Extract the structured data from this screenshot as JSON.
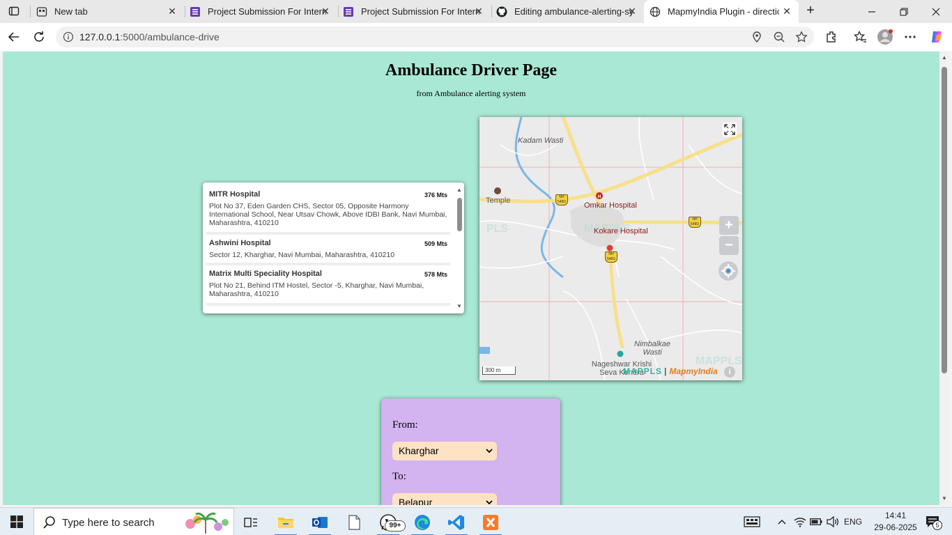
{
  "browser": {
    "tabs": [
      {
        "title": "New tab",
        "icon": "newtab-icon"
      },
      {
        "title": "Project Submission For Interns",
        "icon": "forms-icon"
      },
      {
        "title": "Project Submission For Interns",
        "icon": "forms-icon"
      },
      {
        "title": "Editing ambulance-alerting-sy",
        "icon": "github-icon"
      },
      {
        "title": "MapmyIndia Plugin - direction",
        "icon": "globe-icon"
      }
    ],
    "url_host": "127.0.0.1",
    "url_path": ":5000/ambulance-drive"
  },
  "page": {
    "title": "Ambulance Driver Page",
    "subtitle": "from Ambulance alerting system"
  },
  "hospitals": [
    {
      "name": "MITR Hospital",
      "distance": "376 Mts",
      "address": "Plot No 37, Eden Garden CHS, Sector 05, Opposite Harmony International School, Near Utsav Chowk, Above IDBI Bank, Navi Mumbai, Maharashtra, 410210"
    },
    {
      "name": "Ashwini Hospital",
      "distance": "509 Mts",
      "address": "Sector 12, Kharghar, Navi Mumbai, Maharashtra, 410210"
    },
    {
      "name": "Matrix Multi Speciality Hospital",
      "distance": "578 Mts",
      "address": "Plot No 21, Behind ITM Hostel, Sector -5, Kharghar, Navi Mumbai, Maharashtra, 410210"
    }
  ],
  "map": {
    "labels": {
      "kadam_wasti": "Kadam Wasti",
      "temple": "Temple",
      "omkar": "Omkar Hospital",
      "kokare": "Kokare Hospital",
      "nimbalkae": "Nimbalkae Wasti",
      "nageshwar": "Nageshwar Krishi Seva Kendra"
    },
    "shields": [
      "NH 548D",
      "NH 548D",
      "NH 548G"
    ],
    "zoom_in": "+",
    "zoom_out": "−",
    "scale": "300 m",
    "attribution_1": "MAPPLS",
    "attribution_sep": "|",
    "attribution_2": "MapmyIndia",
    "info": "i"
  },
  "route_form": {
    "from_label": "From:",
    "from_value": "Kharghar",
    "to_label": "To:",
    "to_value": "Belapur"
  },
  "taskbar": {
    "search_placeholder": "Type here to search",
    "whatsapp_badge": "99+",
    "language": "ENG",
    "time": "14:41",
    "date": "29-06-2025",
    "notifications": "5"
  },
  "colors": {
    "page_bg": "#a9e8d4",
    "form_bg": "#d3b3f0",
    "select_bg": "#fde2c4"
  }
}
